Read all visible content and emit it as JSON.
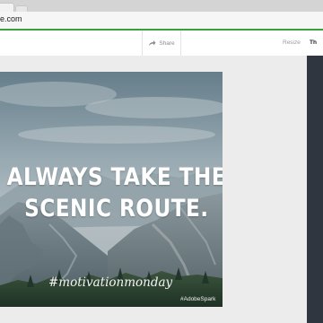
{
  "browser": {
    "url": "e.com"
  },
  "toolbar": {
    "share_label": "Share",
    "share_icon": "share-arrow-icon",
    "resize_label": "Resize",
    "theme_label": "Th"
  },
  "design": {
    "headline_line1": "ALWAYS TAKE THE",
    "headline_line2": "SCENIC ROUTE.",
    "hashtag": "#motivationmonday",
    "watermark": "#AdobeSpark"
  },
  "colors": {
    "load_bar": "#39a03f",
    "right_panel": "#2f3640",
    "headline_text": "#ffffff"
  }
}
